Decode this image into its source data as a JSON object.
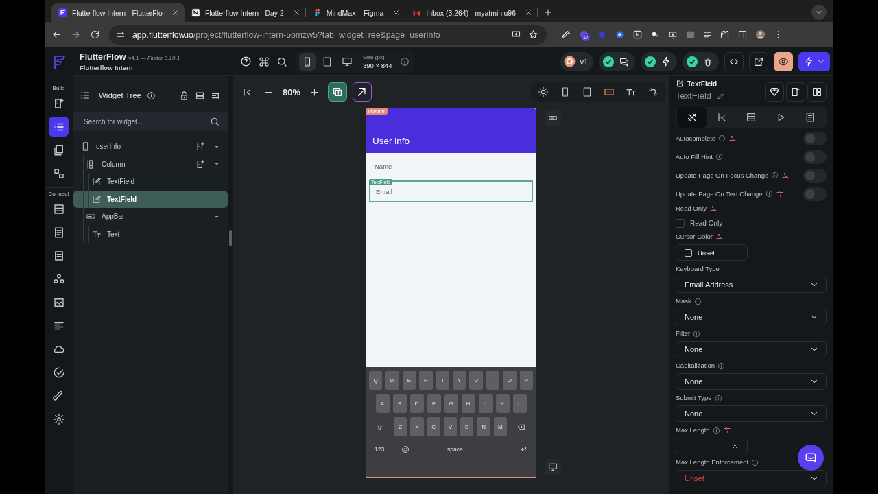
{
  "browser": {
    "tabs": [
      {
        "kind": "flutterflow",
        "title": "Flutterflow Intern - FlutterFlo",
        "selected": true
      },
      {
        "kind": "notion",
        "title": "Flutterflow Intern - Day 2",
        "selected": false
      },
      {
        "kind": "figma",
        "title": "MindMax – Figma",
        "selected": false
      },
      {
        "kind": "gmail",
        "title": "Inbox (3,264) - myatminlu96",
        "selected": false
      }
    ],
    "url_host": "app.flutterflow.io",
    "url_path": "/project/flutterflow-intern-5omzw5?tab=widgetTree&page=userInfo",
    "extension_badge": "17"
  },
  "app": {
    "name": "FlutterFlow",
    "version": "v4.1 — *Flutter 3.19.1*",
    "project": "Flutterflow Intern"
  },
  "rail": [
    {
      "label": "Build",
      "items": [
        {
          "selected": false
        },
        {
          "selected": true
        },
        {
          "selected": false
        },
        {
          "selected": false
        }
      ]
    },
    {
      "label": "Connect",
      "items": [
        {
          "selected": false
        },
        {
          "selected": false
        },
        {
          "selected": false
        },
        {
          "selected": false
        },
        {
          "selected": false
        },
        {
          "selected": false
        },
        {
          "selected": false
        },
        {
          "selected": false
        },
        {
          "selected": false
        },
        {
          "selected": false
        }
      ]
    }
  ],
  "toolbar": {
    "devices": [
      {
        "selected": true
      },
      {
        "selected": false
      },
      {
        "selected": false
      }
    ],
    "size_label": "Size (px)",
    "size_value": "390 × 844",
    "version": "v1",
    "preview_on": true
  },
  "widget_tree": {
    "title": "Widget Tree",
    "placeholder": "Search for widget...",
    "nodes": [
      {
        "kind": "page",
        "label": "userInfo",
        "selected": false,
        "expanded": true,
        "children": [
          {
            "kind": "column",
            "label": "Column",
            "selected": false,
            "expanded": true,
            "children": [
              {
                "kind": "textfield",
                "label": "TextField",
                "selected": false
              },
              {
                "kind": "textfield",
                "label": "TextField",
                "selected": true
              }
            ]
          },
          {
            "kind": "appbar",
            "label": "AppBar",
            "selected": false,
            "expanded": true,
            "children": [
              {
                "kind": "text",
                "label": "Text",
                "selected": false
              }
            ]
          }
        ]
      }
    ]
  },
  "canvas": {
    "zoom": "80%",
    "tools": [
      {
        "active": false
      },
      {
        "active": false
      },
      {
        "active": false
      },
      {
        "active": true
      },
      {
        "active": false
      },
      {
        "active": false
      }
    ]
  },
  "phone": {
    "page_tag": "userInfo",
    "title": "User info",
    "fields": [
      {
        "label": "Name",
        "selected": false
      },
      {
        "placeholder": "Email",
        "selected": true,
        "tag": "TextField"
      }
    ]
  },
  "keyboard": {
    "rows": [
      [
        "Q",
        "W",
        "E",
        "R",
        "T",
        "Y",
        "U",
        "I",
        "O",
        "P"
      ],
      [
        "A",
        "S",
        "D",
        "F",
        "G",
        "H",
        "J",
        "K",
        "L"
      ],
      [
        "Z",
        "X",
        "C",
        "V",
        "B",
        "N",
        "M"
      ]
    ],
    "number_key": "123",
    "space_key": "space",
    "period_key": "."
  },
  "properties": {
    "header": "TextField",
    "name": "TextField",
    "tabs": [
      {
        "selected": true
      },
      {
        "selected": false
      },
      {
        "selected": false
      },
      {
        "selected": false
      },
      {
        "selected": false
      }
    ],
    "items": [
      {
        "kind": "toggle",
        "label": "Autocomplete",
        "info": true,
        "variable": true,
        "on": false
      },
      {
        "kind": "toggle",
        "label": "Auto Fill Hint",
        "info": true,
        "variable": false,
        "on": false
      },
      {
        "kind": "toggle",
        "label": "Update Page On Focus Change",
        "info": true,
        "variable": true,
        "on": false
      },
      {
        "kind": "toggle",
        "label": "Update Page On Text Change",
        "info": true,
        "variable": true,
        "on": false
      },
      {
        "kind": "checkbox",
        "label": "Read Only",
        "info": false,
        "variable": true,
        "option": "Read Only",
        "checked": false
      },
      {
        "kind": "color",
        "label": "Cursor Color",
        "info": false,
        "variable": true,
        "value": "Unset"
      },
      {
        "kind": "dropdown",
        "label": "Keyboard Type",
        "info": false,
        "variable": false,
        "value": "Email Address",
        "warning": false
      },
      {
        "kind": "dropdown",
        "label": "Mask",
        "info": true,
        "variable": false,
        "value": "None",
        "warning": false
      },
      {
        "kind": "dropdown",
        "label": "Filter",
        "info": true,
        "variable": false,
        "value": "None",
        "warning": false
      },
      {
        "kind": "dropdown",
        "label": "Capitalization",
        "info": true,
        "variable": false,
        "value": "None",
        "warning": false
      },
      {
        "kind": "dropdown",
        "label": "Submit Type",
        "info": true,
        "variable": false,
        "value": "None",
        "warning": false
      },
      {
        "kind": "number",
        "label": "Max Length",
        "info": true,
        "variable": true
      },
      {
        "kind": "dropdown",
        "label": "Max Length Enforcement",
        "info": true,
        "variable": false,
        "value": "Unset",
        "warning": true
      }
    ]
  }
}
